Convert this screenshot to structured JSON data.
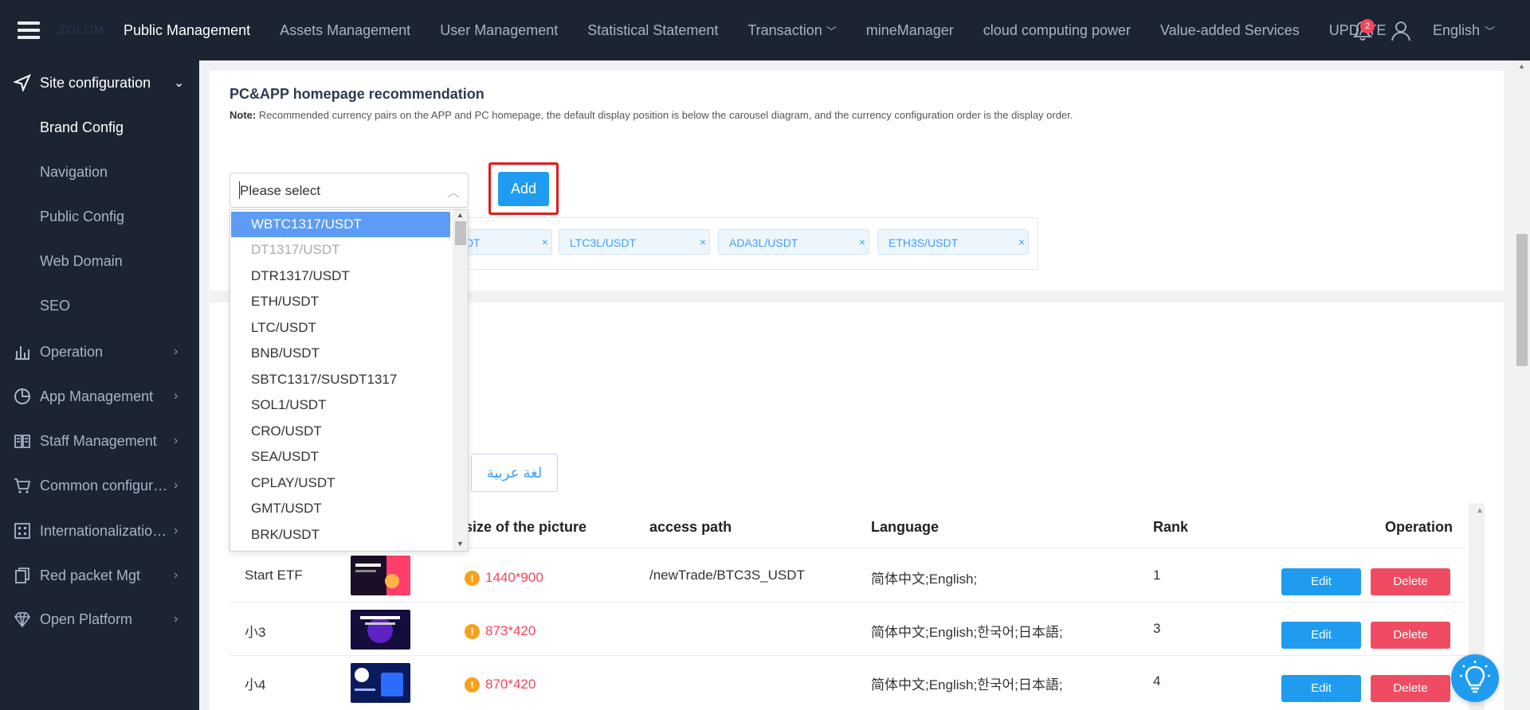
{
  "header": {
    "logo_text": "ZOLOM",
    "nav": [
      {
        "label": "Public Management",
        "active": true
      },
      {
        "label": "Assets Management"
      },
      {
        "label": "User Management"
      },
      {
        "label": "Statistical Statement"
      },
      {
        "label": "Transaction",
        "dropdown": true
      },
      {
        "label": "mineManager"
      },
      {
        "label": "cloud computing power"
      },
      {
        "label": "Value-added Services"
      },
      {
        "label": "UPDATE"
      }
    ],
    "notification_count": "2",
    "language": "English",
    "colors": {
      "bg": "#1c2433",
      "active_text": "#ffffff",
      "text": "#a9b3c6"
    }
  },
  "sidebar": {
    "sections": [
      {
        "label": "Site configuration",
        "icon": "send-icon",
        "expanded": true
      },
      {
        "label": "Operation",
        "icon": "bar-chart-icon"
      },
      {
        "label": "App Management",
        "icon": "pie-chart-icon"
      },
      {
        "label": "Staff Management",
        "icon": "book-icon"
      },
      {
        "label": "Common configura...",
        "icon": "cart-icon"
      },
      {
        "label": "Internationalization...",
        "icon": "grid-icon"
      },
      {
        "label": "Red packet Mgt",
        "icon": "copy-icon"
      },
      {
        "label": "Open Platform",
        "icon": "diamond-icon"
      }
    ],
    "sub_items": [
      "Brand Config",
      "Navigation",
      "Public Config",
      "Web Domain",
      "SEO"
    ]
  },
  "recommendation": {
    "title": "PC&APP homepage recommendation",
    "note_label": "Note:",
    "note_text": "Recommended currency pairs on the APP and PC homepage, the default display position is below the carousel diagram, and the currency configuration order is the display order.",
    "select_placeholder": "Please select",
    "add_label": "Add",
    "tags": [
      "DT",
      "LTC3L/USDT",
      "ADA3L/USDT",
      "ETH3S/USDT"
    ],
    "close_glyph": "×"
  },
  "dropdown": {
    "options": [
      {
        "label": "WBTC1317/USDT",
        "state": "selected"
      },
      {
        "label": "DT1317/USDT",
        "state": "disabled"
      },
      {
        "label": "DTR1317/USDT"
      },
      {
        "label": "ETH/USDT"
      },
      {
        "label": "LTC/USDT"
      },
      {
        "label": "BNB/USDT"
      },
      {
        "label": "SBTC1317/SUSDT1317"
      },
      {
        "label": "SOL1/USDT"
      },
      {
        "label": "CRO/USDT"
      },
      {
        "label": "SEA/USDT"
      },
      {
        "label": "CPLAY/USDT"
      },
      {
        "label": "GMT/USDT"
      },
      {
        "label": "BRK/USDT"
      }
    ]
  },
  "banners": {
    "language_tab": "لغة عربية",
    "columns": {
      "size": "size of the picture",
      "path": "access path",
      "language": "Language",
      "rank": "Rank",
      "operation": "Operation"
    },
    "rows": [
      {
        "name": "Start ETF",
        "size": "1440*900",
        "path": "/newTrade/BTC3S_USDT",
        "language": "简体中文;English;",
        "rank": "1",
        "thumb_colors": [
          "#1a0f26",
          "#ff3e6c"
        ]
      },
      {
        "name": "小3",
        "size": "873*420",
        "path": "",
        "language": "简体中文;English;한국어;日本語;",
        "rank": "3",
        "thumb_colors": [
          "#150d3d",
          "#7b2cff"
        ]
      },
      {
        "name": "小4",
        "size": "870*420",
        "path": "",
        "language": "简体中文;English;한국어;日本語;",
        "rank": "4",
        "thumb_colors": [
          "#0b1a5c",
          "#2b6cff"
        ]
      }
    ],
    "edit_label": "Edit",
    "delete_label": "Delete",
    "warn_glyph": "!"
  }
}
